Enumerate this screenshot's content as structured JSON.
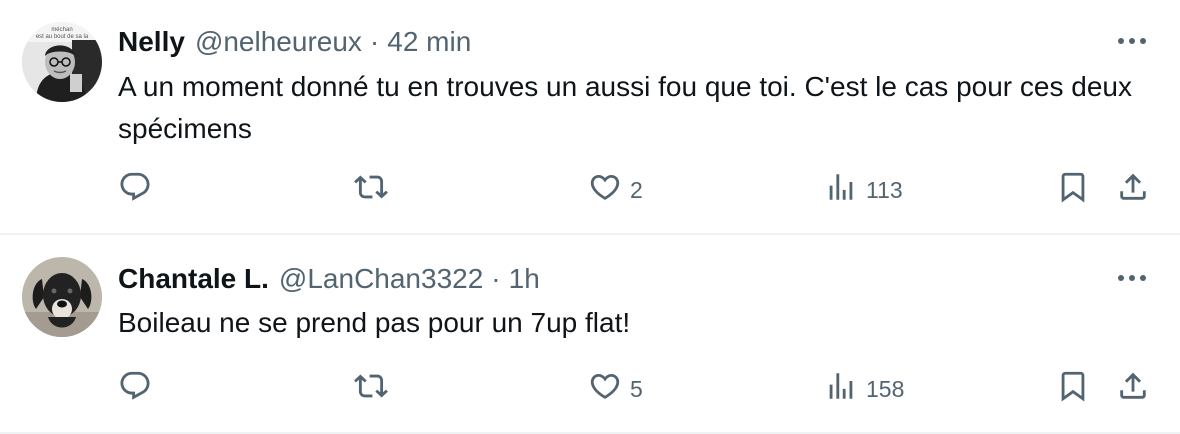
{
  "tweets": [
    {
      "name": "Nelly",
      "handle": "@nelheureux",
      "separator": "·",
      "time": "42 min",
      "text": "A un moment donné tu en trouves un aussi fou que toi. C'est le cas pour ces deux spécimens",
      "avatar_caption": "...méchan... est au bout de sa la...",
      "replies": "",
      "retweets": "",
      "likes": "2",
      "views": "113"
    },
    {
      "name": "Chantale L.",
      "handle": "@LanChan3322",
      "separator": "·",
      "time": "1h",
      "text": "Boileau ne se prend pas pour un 7up flat!",
      "replies": "",
      "retweets": "",
      "likes": "5",
      "views": "158"
    }
  ],
  "icons": {
    "more": "more-icon",
    "reply": "reply-icon",
    "retweet": "retweet-icon",
    "like": "heart-icon",
    "views": "views-icon",
    "bookmark": "bookmark-icon",
    "share": "share-icon"
  },
  "colors": {
    "text": "#0f1419",
    "secondary": "#536471",
    "divider": "#eff3f4"
  }
}
